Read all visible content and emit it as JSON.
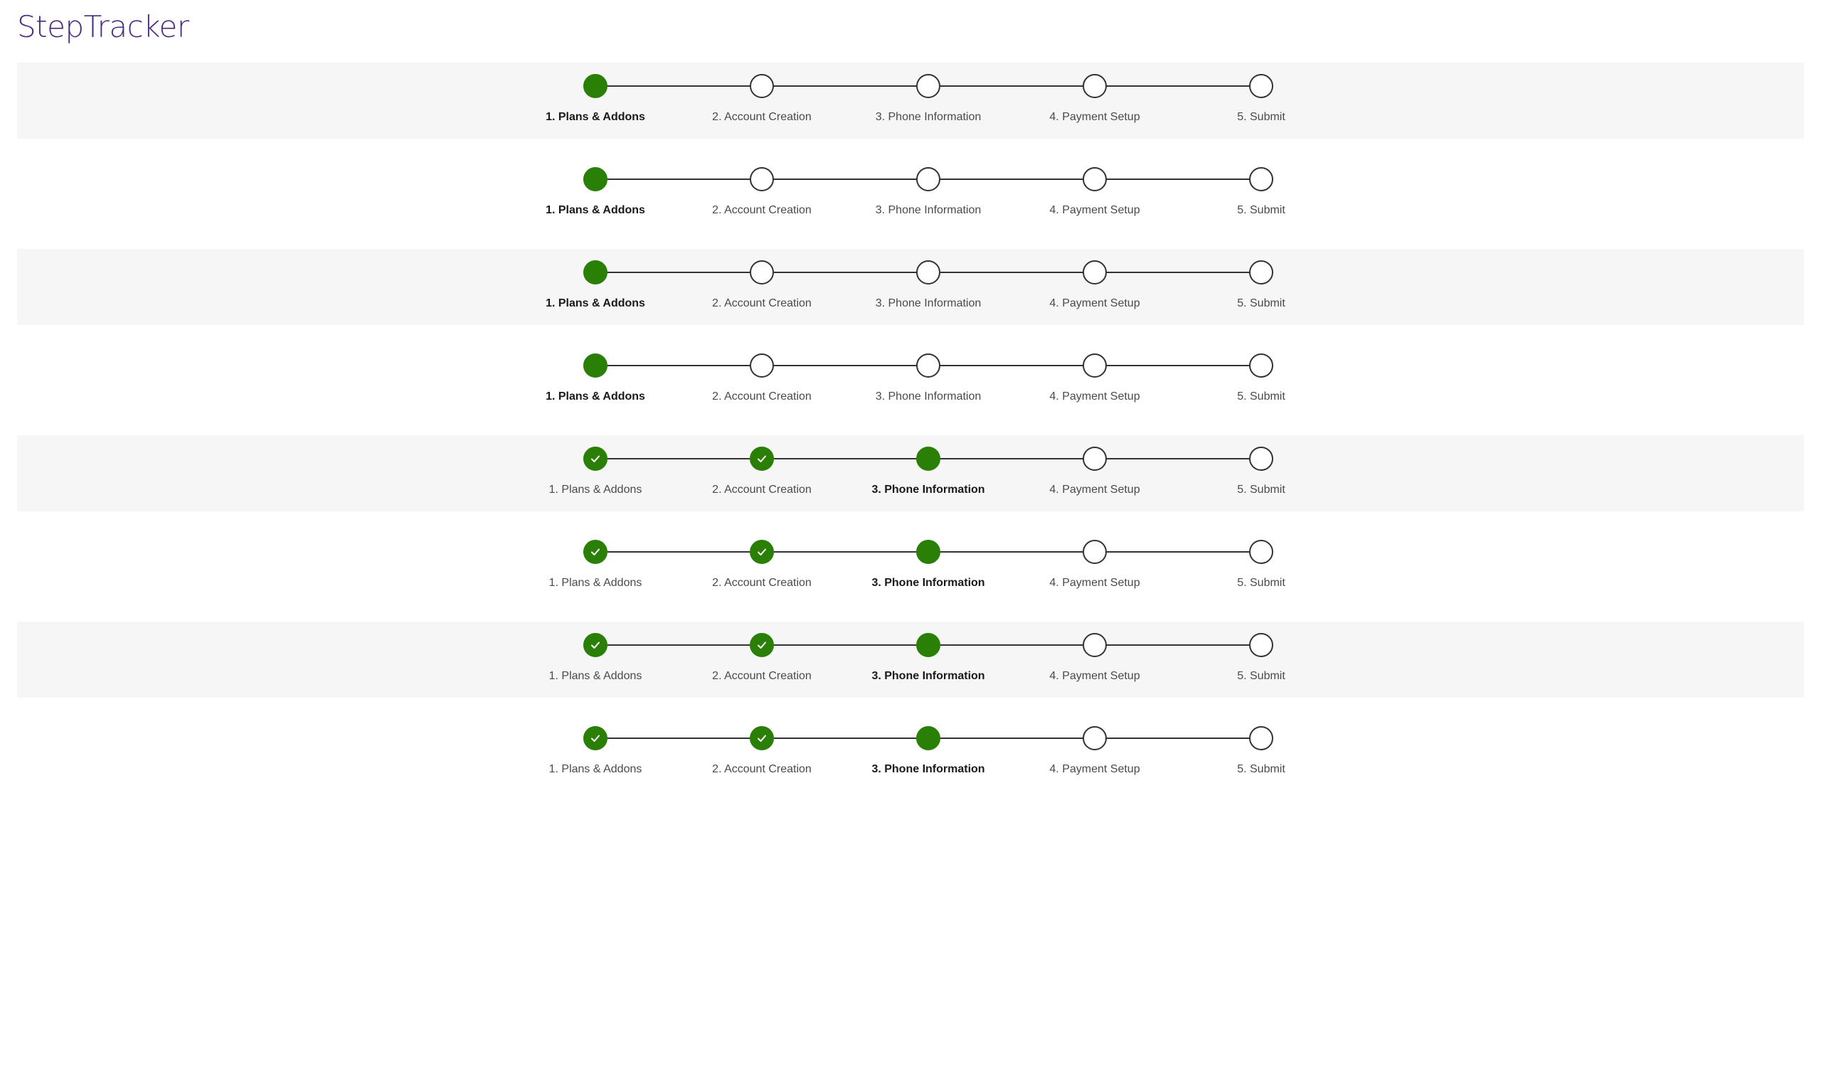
{
  "title": "StepTracker",
  "colors": {
    "title": "#4b2a82",
    "accent": "#2a7f07",
    "line": "#333333",
    "row_shade": "#f6f6f6"
  },
  "steps": [
    "1. Plans & Addons",
    "2. Account Creation",
    "3. Phone Information",
    "4. Payment Setup",
    "5. Submit"
  ],
  "trackers": [
    {
      "active_step": 1,
      "shaded": true
    },
    {
      "active_step": 1,
      "shaded": false
    },
    {
      "active_step": 1,
      "shaded": true
    },
    {
      "active_step": 1,
      "shaded": false
    },
    {
      "active_step": 3,
      "shaded": true
    },
    {
      "active_step": 3,
      "shaded": false
    },
    {
      "active_step": 3,
      "shaded": true
    },
    {
      "active_step": 3,
      "shaded": false
    }
  ],
  "icons": {
    "completed": "check-icon"
  }
}
